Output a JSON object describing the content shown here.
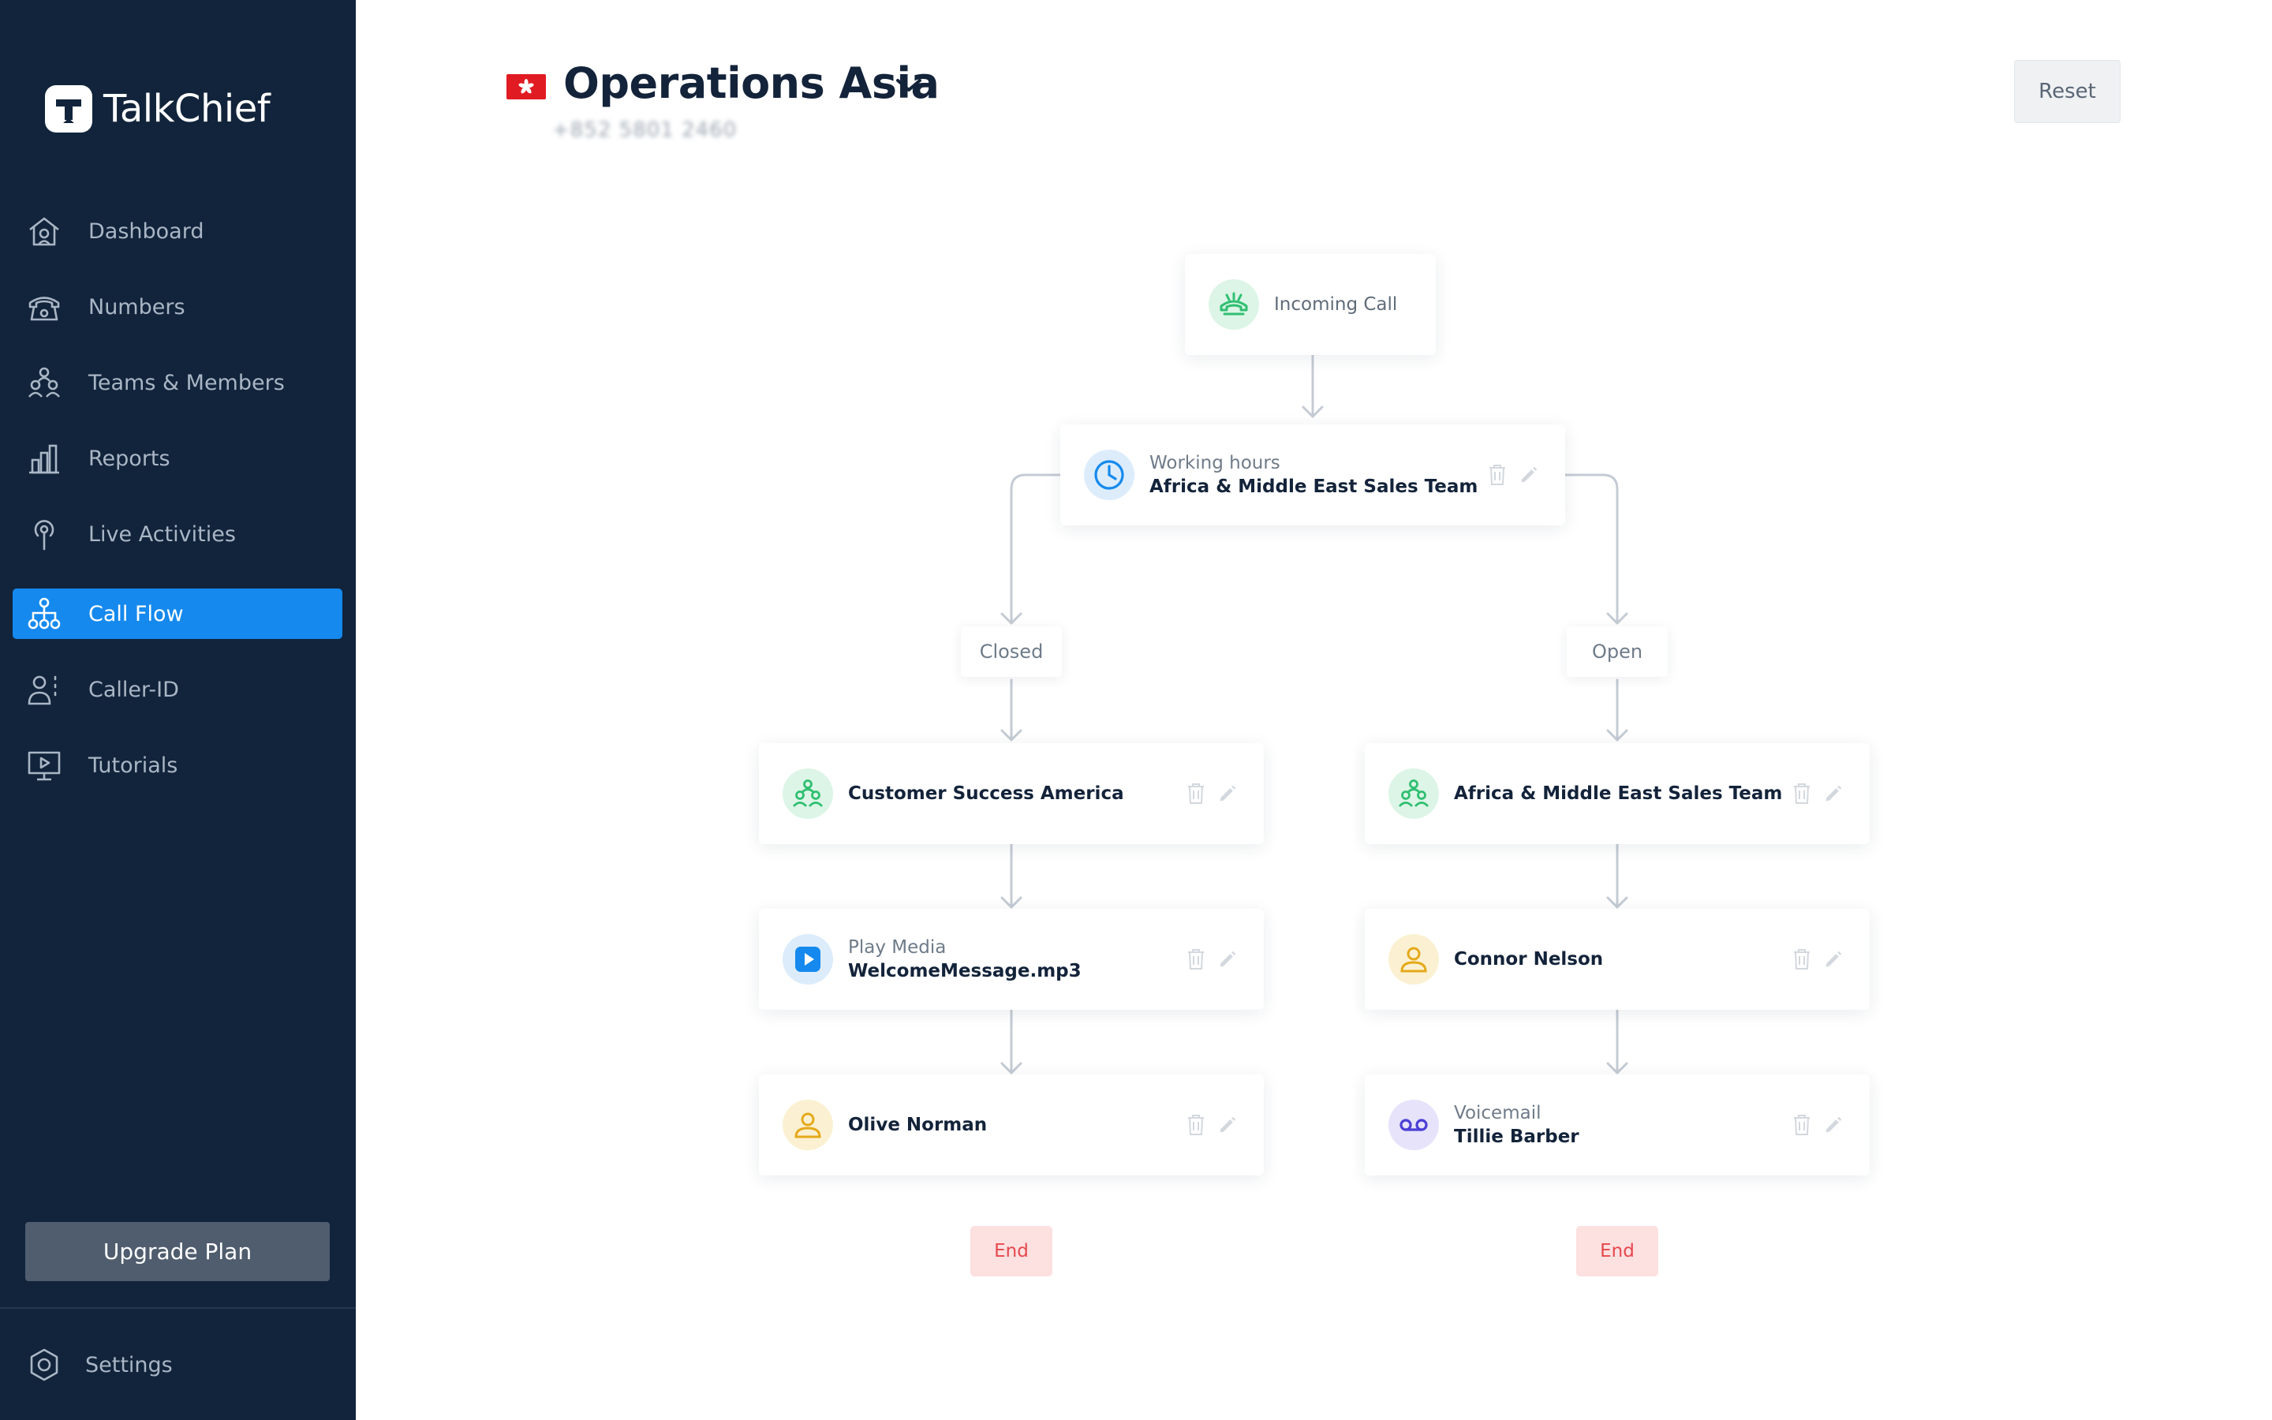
{
  "brand": {
    "name": "TalkChief"
  },
  "sidebar": {
    "items": [
      {
        "label": "Dashboard",
        "icon": "home-icon"
      },
      {
        "label": "Numbers",
        "icon": "phone-icon"
      },
      {
        "label": "Teams & Members",
        "icon": "team-icon"
      },
      {
        "label": "Reports",
        "icon": "bar-chart-icon"
      },
      {
        "label": "Live Activities",
        "icon": "broadcast-icon"
      },
      {
        "label": "Call Flow",
        "icon": "flow-icon",
        "active": true
      },
      {
        "label": "Caller-ID",
        "icon": "caller-id-icon"
      },
      {
        "label": "Tutorials",
        "icon": "monitor-play-icon"
      }
    ],
    "upgrade_label": "Upgrade Plan",
    "settings_label": "Settings"
  },
  "header": {
    "title": "Operations Asia",
    "phone_number_masked": "+852 5801 2460",
    "reset_label": "Reset",
    "flag_icon": "hong-kong-flag-icon"
  },
  "flow": {
    "incoming": {
      "label": "Incoming Call"
    },
    "condition": {
      "sub": "Working hours",
      "main": "Africa & Middle East Sales Team"
    },
    "branches": {
      "closed": {
        "label": "Closed",
        "steps": [
          {
            "sub": "",
            "main": "Customer Success America",
            "icon": "team-icon"
          },
          {
            "sub": "Play Media",
            "main": "WelcomeMessage.mp3",
            "icon": "play-icon"
          },
          {
            "sub": "",
            "main": "Olive Norman",
            "icon": "user-icon"
          }
        ],
        "end_label": "End"
      },
      "open": {
        "label": "Open",
        "steps": [
          {
            "sub": "",
            "main": "Africa & Middle East Sales Team",
            "icon": "team-icon"
          },
          {
            "sub": "",
            "main": "Connor Nelson",
            "icon": "user-icon"
          },
          {
            "sub": "Voicemail",
            "main": "Tillie Barber",
            "icon": "voicemail-icon"
          }
        ],
        "end_label": "End"
      }
    }
  },
  "colors": {
    "sidebar_bg": "#11243b",
    "accent": "#1589ee",
    "green": "#2fbf71",
    "blue": "#1589ee",
    "yellow": "#e5a91a",
    "purple": "#4b3fd6",
    "end_red": "#e5484d"
  }
}
